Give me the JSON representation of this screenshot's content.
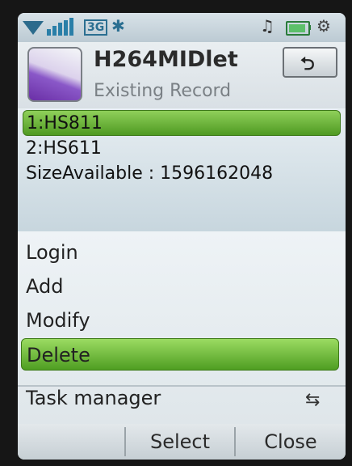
{
  "status": {
    "network": "3G",
    "bluetooth_icon": "bluetooth-icon",
    "music_icon": "music-note-icon",
    "battery_icon": "battery-icon",
    "taskmgr_icon": "task-manager-icon"
  },
  "header": {
    "title": "H264MIDlet",
    "subtitle": "Existing Record",
    "back_label": "⮌"
  },
  "records": {
    "items": [
      "1:HS811",
      "2:HS611"
    ],
    "size_label": "SizeAvailable : 1596162048"
  },
  "menu": {
    "items": [
      "Login",
      "Add",
      "Modify",
      "Delete"
    ],
    "task_manager": "Task manager"
  },
  "softkeys": {
    "left": "",
    "center": "Select",
    "right": "Close"
  },
  "colors": {
    "selection": "#6bb83a",
    "background": "#cfd8df"
  }
}
